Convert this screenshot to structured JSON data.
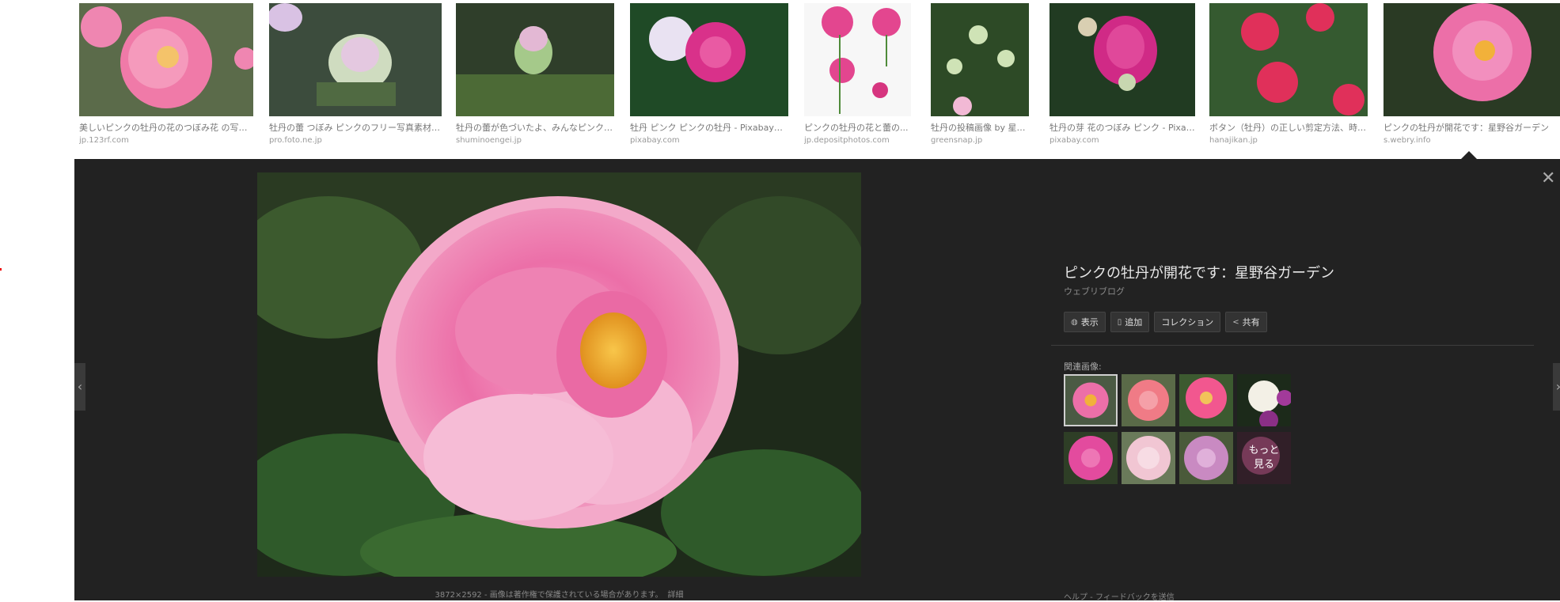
{
  "strip": {
    "thumbnails": [
      {
        "caption": "美しいピンクの牡丹の花のつぼみ花 の写真...",
        "source": "jp.123rf.com"
      },
      {
        "caption": "牡丹の蕾 つぼみ ピンクのフリー写真素材 無...",
        "source": "pro.foto.ne.jp"
      },
      {
        "caption": "牡丹の蕾が色づいたよ、みんなピンク色...",
        "source": "shuminoengei.jp"
      },
      {
        "caption": "牡丹 ピンク ピンクの牡丹 - Pixabayの...",
        "source": "pixabay.com"
      },
      {
        "caption": "ピンクの牡丹の花と蕾の...",
        "source": "jp.depositphotos.com"
      },
      {
        "caption": "牡丹の投稿画像 by 星月さ...",
        "source": "greensnap.jp"
      },
      {
        "caption": "牡丹の芽 花のつぼみ ピンク - Pixab...",
        "source": "pixabay.com"
      },
      {
        "caption": "ボタン（牡丹）の正しい剪定方法、時期...",
        "source": "hanajikan.jp"
      },
      {
        "caption": "ピンクの牡丹が開花です：星野谷ガーデン",
        "source": "s.webry.info"
      }
    ]
  },
  "viewer": {
    "title": "ピンクの牡丹が開花です：星野谷ガーデン",
    "subtitle": "ウェブリブログ",
    "buttons": {
      "view": "表示",
      "save": "追加",
      "collection": "コレクション",
      "share": "共有"
    },
    "related_label": "関連画像:",
    "more_label_1": "もっと",
    "more_label_2": "見る",
    "meta": "3872×2592 - 画像は著作権で保護されている場合があります。",
    "details_link": "詳細",
    "help": "ヘルプ - フィードバックを送信"
  },
  "colors": {
    "panel_bg": "#222222",
    "peony_pink": "#ec6fa8",
    "leaf_green": "#2f5a2a"
  }
}
